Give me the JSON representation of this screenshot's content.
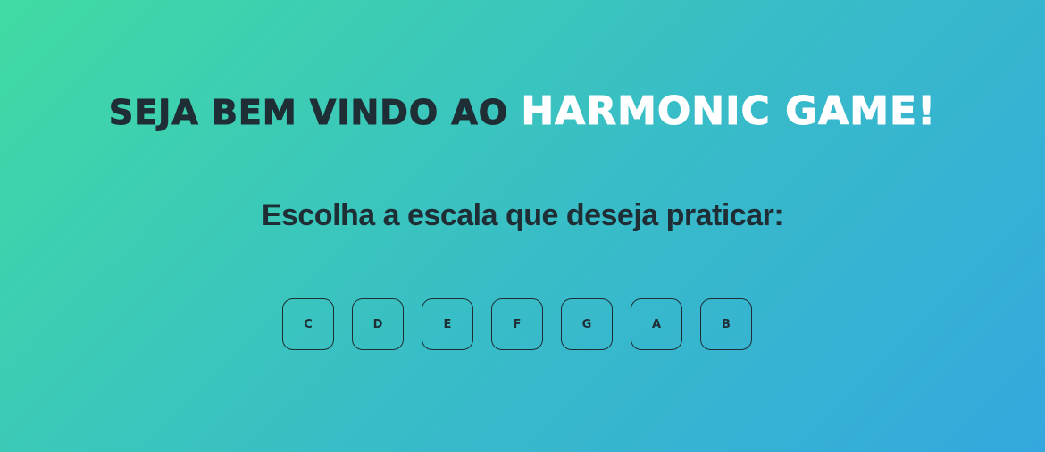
{
  "header": {
    "title_prefix": "SEJA BEM VINDO AO ",
    "title_highlight": "HARMONIC GAME!"
  },
  "main": {
    "prompt": "Escolha a escala que deseja praticar:",
    "scales": [
      {
        "label": "C"
      },
      {
        "label": "D"
      },
      {
        "label": "E"
      },
      {
        "label": "F"
      },
      {
        "label": "G"
      },
      {
        "label": "A"
      },
      {
        "label": "B"
      }
    ]
  },
  "colors": {
    "gradient_start": "#40dba3",
    "gradient_end": "#34a8de",
    "text_dark": "#1f2d35",
    "text_highlight": "#ffffff"
  }
}
